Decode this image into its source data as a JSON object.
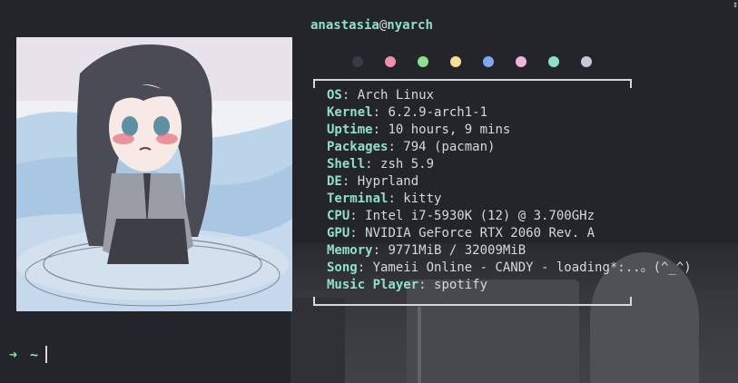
{
  "prompt": {
    "user": "anastasia",
    "at": "@",
    "host": "nyarch"
  },
  "palette": [
    "#393c46",
    "#f08fa8",
    "#8ee08e",
    "#f5df95",
    "#7fa8ec",
    "#f2b3dd",
    "#8ee0c7",
    "#c6c9d8"
  ],
  "info": [
    {
      "key": "OS",
      "value": "Arch Linux"
    },
    {
      "key": "Kernel",
      "value": "6.2.9-arch1-1"
    },
    {
      "key": "Uptime",
      "value": "10 hours, 9 mins"
    },
    {
      "key": "Packages",
      "value": "794 (pacman)"
    },
    {
      "key": "Shell",
      "value": "zsh 5.9"
    },
    {
      "key": "DE",
      "value": "Hyprland"
    },
    {
      "key": "Terminal",
      "value": "kitty"
    },
    {
      "key": "CPU",
      "value": "Intel i7-5930K (12) @ 3.700GHz"
    },
    {
      "key": "GPU",
      "value": "NVIDIA GeForce RTX 2060 Rev. A"
    },
    {
      "key": "Memory",
      "value": "9771MiB / 32009MiB"
    },
    {
      "key": "Song",
      "value": "Yameii Online - CANDY - loading*:..。(^_^)"
    },
    {
      "key": "Music Player",
      "value": "spotify"
    }
  ],
  "shell": {
    "arrow": "➜",
    "cwd": "~"
  },
  "corner_marker": "↕"
}
